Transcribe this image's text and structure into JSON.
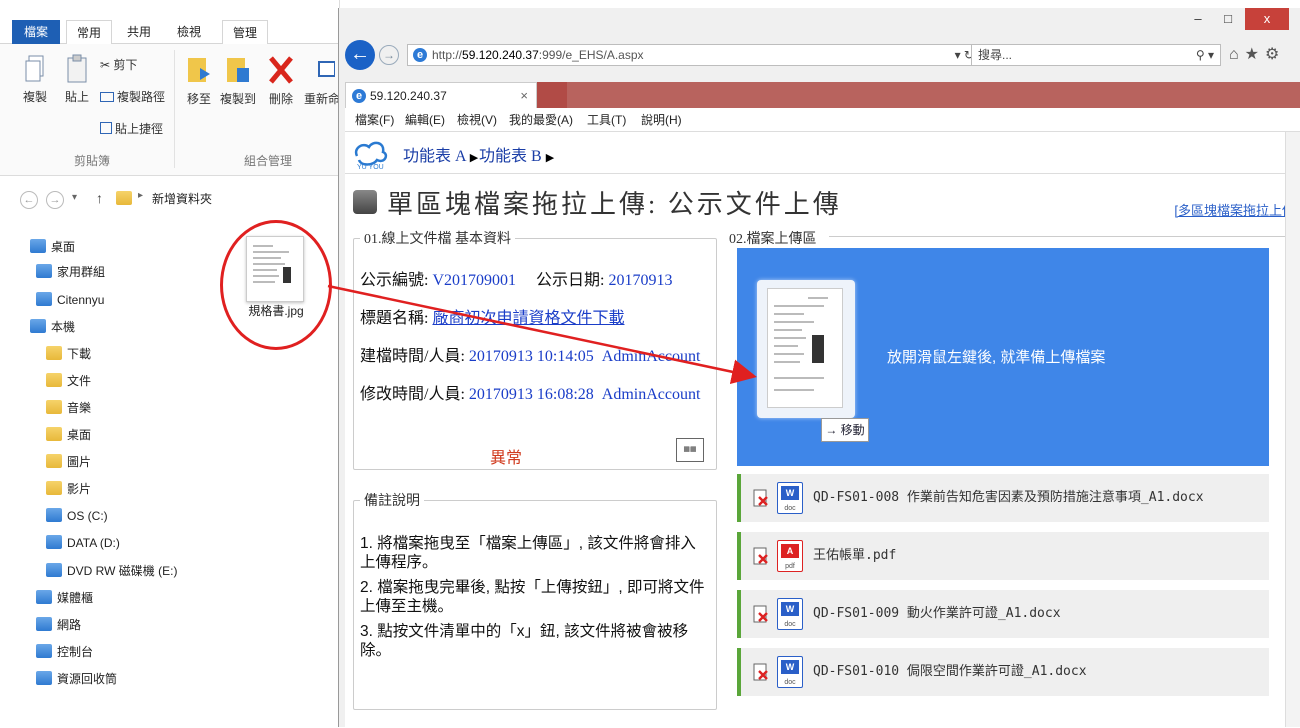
{
  "explorer": {
    "tabs": [
      "檔案",
      "常用",
      "共用",
      "檢視",
      "管理"
    ],
    "ribbon": {
      "copy": "複製",
      "paste": "貼上",
      "cut": "剪下",
      "copy_path": "複製路徑",
      "paste_shortcut": "貼上捷徑",
      "move_to": "移至",
      "copy_to": "複製到",
      "delete": "刪除",
      "rename": "重新命",
      "group_clipboard": "剪貼簿",
      "group_organize": "組合管理"
    },
    "address": "新增資料夾",
    "tree": [
      {
        "label": "桌面",
        "icon": "desktop-icon"
      },
      {
        "label": "家用群組",
        "icon": "homegroup-icon"
      },
      {
        "label": "Citennyu",
        "icon": "user-folder-icon"
      },
      {
        "label": "本機",
        "icon": "computer-icon"
      },
      {
        "label": "下載",
        "icon": "downloads-folder-icon"
      },
      {
        "label": "文件",
        "icon": "documents-folder-icon"
      },
      {
        "label": "音樂",
        "icon": "music-folder-icon"
      },
      {
        "label": "桌面",
        "icon": "desktop-folder-icon"
      },
      {
        "label": "圖片",
        "icon": "pictures-folder-icon"
      },
      {
        "label": "影片",
        "icon": "videos-folder-icon"
      },
      {
        "label": "OS (C:)",
        "icon": "drive-c-icon"
      },
      {
        "label": "DATA (D:)",
        "icon": "drive-d-icon"
      },
      {
        "label": "DVD RW 磁碟機 (E:)",
        "icon": "dvd-drive-icon"
      },
      {
        "label": "媒體櫃",
        "icon": "libraries-icon"
      },
      {
        "label": "網路",
        "icon": "network-icon"
      },
      {
        "label": "控制台",
        "icon": "control-panel-icon"
      },
      {
        "label": "資源回收筒",
        "icon": "recycle-bin-icon"
      }
    ],
    "file_name": "規格書.jpg"
  },
  "browser": {
    "url_prefix": "http://",
    "url_host": "59.120.240.37",
    "url_path": ":999/e_EHS/A.aspx",
    "url_controls": "▾ ↻",
    "search_placeholder": "搜尋...",
    "search_icon": "⚲ ▾",
    "toolbar_icons": "⌂★⚙",
    "tab_title": "59.120.240.37",
    "tab_close": "×",
    "window_controls": {
      "minimize": "–",
      "maximize": "□",
      "close": "x"
    },
    "menu": [
      "檔案(F)",
      "編輯(E)",
      "檢視(V)",
      "我的最愛(A)",
      "工具(T)",
      "說明(H)"
    ]
  },
  "page": {
    "nav": [
      "功能表 A",
      "功能表 B"
    ],
    "title": "單區塊檔案拖拉上傳: 公示文件上傳",
    "multi_link": "[多區塊檔案拖拉上傳",
    "basic_legend": "01.線上文件檔 基本資料",
    "fields": {
      "notice_no_label": "公示編號:",
      "notice_no": "V201709001",
      "notice_date_label": "公示日期:",
      "notice_date": "20170913",
      "subject_label": "標題名稱:",
      "subject": "廠商初次申請資格文件下載",
      "created_label": "建檔時間/人員:",
      "created": "20170913 10:14:05",
      "created_by": "AdminAccount",
      "modified_label": "修改時間/人員:",
      "modified": "20170913 16:08:28",
      "modified_by": "AdminAccount"
    },
    "status": "異常",
    "notes_legend": "備註說明",
    "notes": [
      "1. 將檔案拖曳至「檔案上傳區」, 該文件將會排入上傳程序。",
      "2. 檔案拖曳完畢後, 點按「上傳按鈕」, 即可將文件上傳至主機。",
      "3. 點按文件清單中的「x」鈕, 該文件將被會被移除。"
    ],
    "upload_legend": "02.檔案上傳區",
    "drop_message": "放開滑鼠左鍵後, 就準備上傳檔案",
    "move_badge": "→ 移動",
    "files": [
      {
        "name": "QD-FS01-008 作業前告知危害因素及預防措施注意事項_A1.docx",
        "type": "word",
        "tag": "W",
        "sub": "doc"
      },
      {
        "name": "王佑帳單.pdf",
        "type": "pdf",
        "tag": "A",
        "sub": "pdf"
      },
      {
        "name": "QD-FS01-009 動火作業許可證_A1.docx",
        "type": "word",
        "tag": "W",
        "sub": "doc"
      },
      {
        "name": "QD-FS01-010 侷限空間作業許可證_A1.docx",
        "type": "word",
        "tag": "W",
        "sub": "doc"
      }
    ]
  },
  "colors": {
    "dropzone": "#3f86e8",
    "annotation": "#e02020",
    "link": "#1a3dc8",
    "status_abnormal": "#d03a1e"
  }
}
